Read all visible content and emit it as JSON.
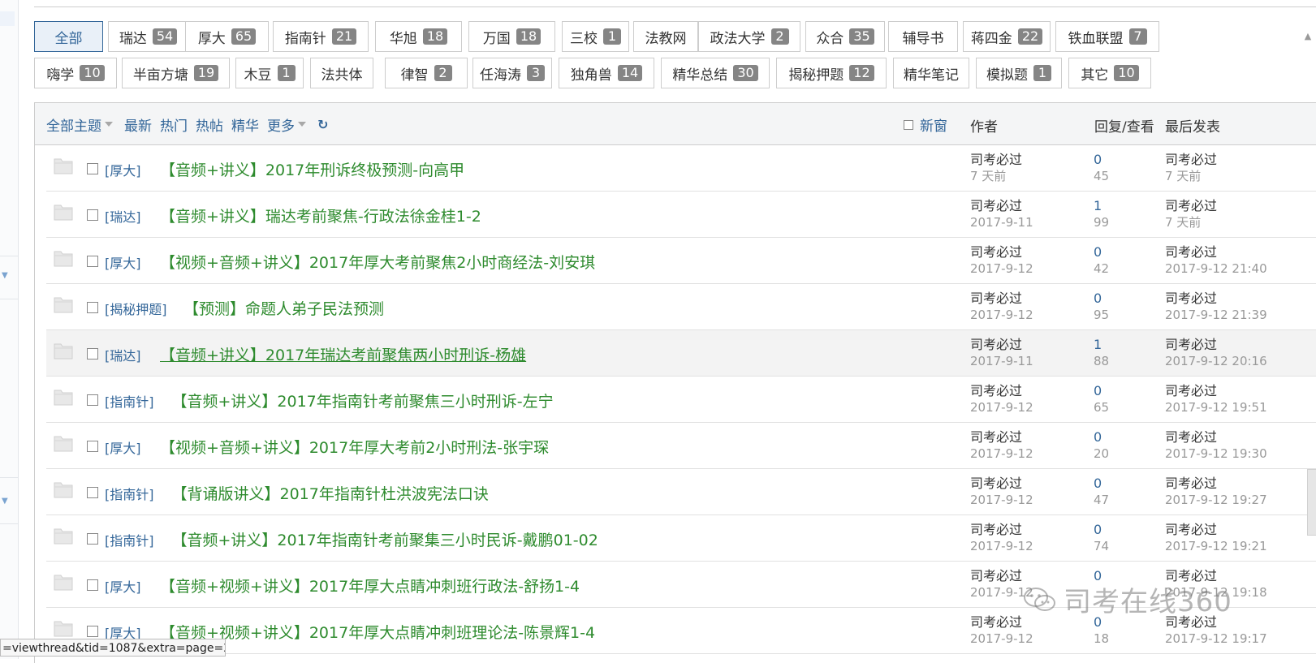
{
  "filter_tags": [
    {
      "label": "全部",
      "count": null,
      "active": true
    },
    {
      "label": "瑞达",
      "count": "54"
    },
    {
      "label": "厚大",
      "count": "65"
    },
    {
      "label": "指南针",
      "count": "21"
    },
    {
      "label": "华旭",
      "count": "18"
    },
    {
      "label": "万国",
      "count": "18"
    },
    {
      "label": "三校",
      "count": "1"
    },
    {
      "label": "法教网",
      "count": null
    },
    {
      "label": "政法大学",
      "count": "2"
    },
    {
      "label": "众合",
      "count": "35"
    },
    {
      "label": "辅导书",
      "count": null
    },
    {
      "label": "蒋四金",
      "count": "22"
    },
    {
      "label": "铁血联盟",
      "count": "7"
    },
    {
      "label": "嗨学",
      "count": "10"
    },
    {
      "label": "半亩方塘",
      "count": "19"
    },
    {
      "label": "木豆",
      "count": "1"
    },
    {
      "label": "法共体",
      "count": null
    },
    {
      "label": "律智",
      "count": "2"
    },
    {
      "label": "任海涛",
      "count": "3"
    },
    {
      "label": "独角兽",
      "count": "14"
    },
    {
      "label": "精华总结",
      "count": "30"
    },
    {
      "label": "揭秘押题",
      "count": "12"
    },
    {
      "label": "精华笔记",
      "count": null
    },
    {
      "label": "模拟题",
      "count": "1"
    },
    {
      "label": "其它",
      "count": "10"
    }
  ],
  "header": {
    "all_topics": "全部主题",
    "latest": "最新",
    "hot": "热门",
    "hot_posts": "热帖",
    "digest": "精华",
    "more": "更多",
    "refresh_icon": "refresh-icon",
    "new_window": "新窗",
    "col_author": "作者",
    "col_reply_view": "回复/查看",
    "col_last_post": "最后发表"
  },
  "threads": [
    {
      "category": "[厚大]",
      "title": "【音频+讲义】2017年刑诉终极预测-向高甲",
      "author": "司考必过",
      "date": "7 天前",
      "replies": "0",
      "views": "45",
      "last_user": "司考必过",
      "last_time": "7 天前"
    },
    {
      "category": "[瑞达]",
      "title": "【音频+讲义】瑞达考前聚焦-行政法徐金桂1-2",
      "author": "司考必过",
      "date": "2017-9-11",
      "replies": "1",
      "views": "99",
      "last_user": "司考必过",
      "last_time": "7 天前"
    },
    {
      "category": "[厚大]",
      "title": "【视频+音频+讲义】2017年厚大考前聚焦2小时商经法-刘安琪",
      "author": "司考必过",
      "date": "2017-9-12",
      "replies": "0",
      "views": "42",
      "last_user": "司考必过",
      "last_time": "2017-9-12 21:40"
    },
    {
      "category": "[揭秘押题]",
      "title": "【预测】命题人弟子民法预测",
      "author": "司考必过",
      "date": "2017-9-12",
      "replies": "0",
      "views": "95",
      "last_user": "司考必过",
      "last_time": "2017-9-12 21:39"
    },
    {
      "category": "[瑞达]",
      "title": "【音频+讲义】2017年瑞达考前聚焦两小时刑诉-杨雄",
      "author": "司考必过",
      "date": "2017-9-11",
      "replies": "1",
      "views": "88",
      "last_user": "司考必过",
      "last_time": "2017-9-12 20:16",
      "hover": true
    },
    {
      "category": "[指南针]",
      "title": "【音频+讲义】2017年指南针考前聚焦三小时刑诉-左宁",
      "author": "司考必过",
      "date": "2017-9-12",
      "replies": "0",
      "views": "65",
      "last_user": "司考必过",
      "last_time": "2017-9-12 19:51"
    },
    {
      "category": "[厚大]",
      "title": "【视频+音频+讲义】2017年厚大考前2小时刑法-张宇琛",
      "author": "司考必过",
      "date": "2017-9-12",
      "replies": "0",
      "views": "20",
      "last_user": "司考必过",
      "last_time": "2017-9-12 19:30"
    },
    {
      "category": "[指南针]",
      "title": "【背诵版讲义】2017年指南针杜洪波宪法口诀",
      "author": "司考必过",
      "date": "2017-9-12",
      "replies": "0",
      "views": "47",
      "last_user": "司考必过",
      "last_time": "2017-9-12 19:27"
    },
    {
      "category": "[指南针]",
      "title": "【音频+讲义】2017年指南针考前聚集三小时民诉-戴鹏01-02",
      "author": "司考必过",
      "date": "2017-9-12",
      "replies": "0",
      "views": "74",
      "last_user": "司考必过",
      "last_time": "2017-9-12 19:21"
    },
    {
      "category": "[厚大]",
      "title": "【音频+视频+讲义】2017年厚大点睛冲刺班行政法-舒扬1-4",
      "author": "司考必过",
      "date": "2017-9-12",
      "replies": "0",
      "views": "",
      "last_user": "司考必过",
      "last_time": "2017-9-12 19:18"
    },
    {
      "category": "[厚大]",
      "title": "【音频+视频+讲义】2017年厚大点睛冲刺班理论法-陈景辉1-4",
      "author": "司考必过",
      "date": "2017-9-12",
      "replies": "0",
      "views": "18",
      "last_user": "司考必过",
      "last_time": "2017-9-12 19:17"
    }
  ],
  "status_url": "=viewthread&tid=1087&extra=page=2",
  "watermark": "司考在线360",
  "colors": {
    "link_blue": "#336699",
    "title_green": "#2e8b2e",
    "muted": "#999999",
    "badge_gray": "#858585"
  }
}
